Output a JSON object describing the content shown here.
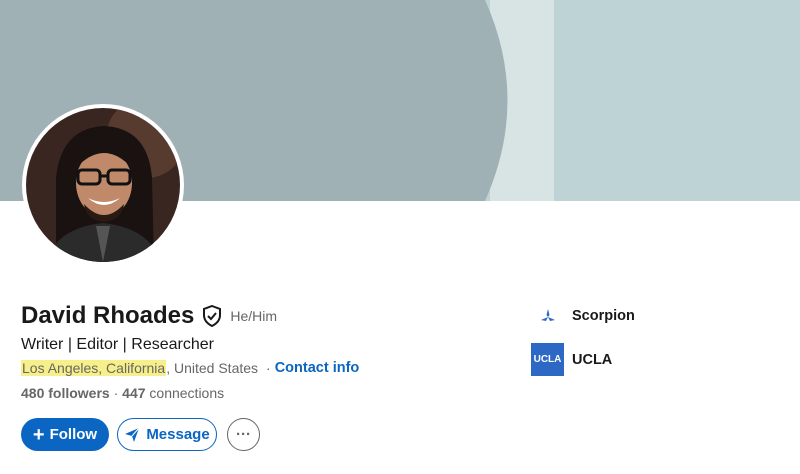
{
  "profile": {
    "name": "David Rhoades",
    "pronouns": "He/Him",
    "headline": "Writer | Editor | Researcher",
    "location_city": "Los Angeles, California",
    "location_country": ", United States",
    "separator": "·",
    "contact_info_label": "Contact info",
    "followers": "480 followers",
    "counts_separator": " · ",
    "connections_count": "447",
    "connections_label": " connections"
  },
  "actions": {
    "follow_icon": "+",
    "follow_label": "Follow",
    "message_label": "Message",
    "more_label": "···"
  },
  "sidebar": {
    "items": [
      {
        "label": "Scorpion",
        "icon": "scorpion-logo"
      },
      {
        "label": "UCLA",
        "logo_text": "UCLA",
        "icon": "ucla-logo"
      }
    ]
  },
  "colors": {
    "accent": "#0a66c2",
    "highlight": "#f7f08a",
    "banner_left": "#9fb1b5",
    "banner_right": "#bed3d5"
  }
}
